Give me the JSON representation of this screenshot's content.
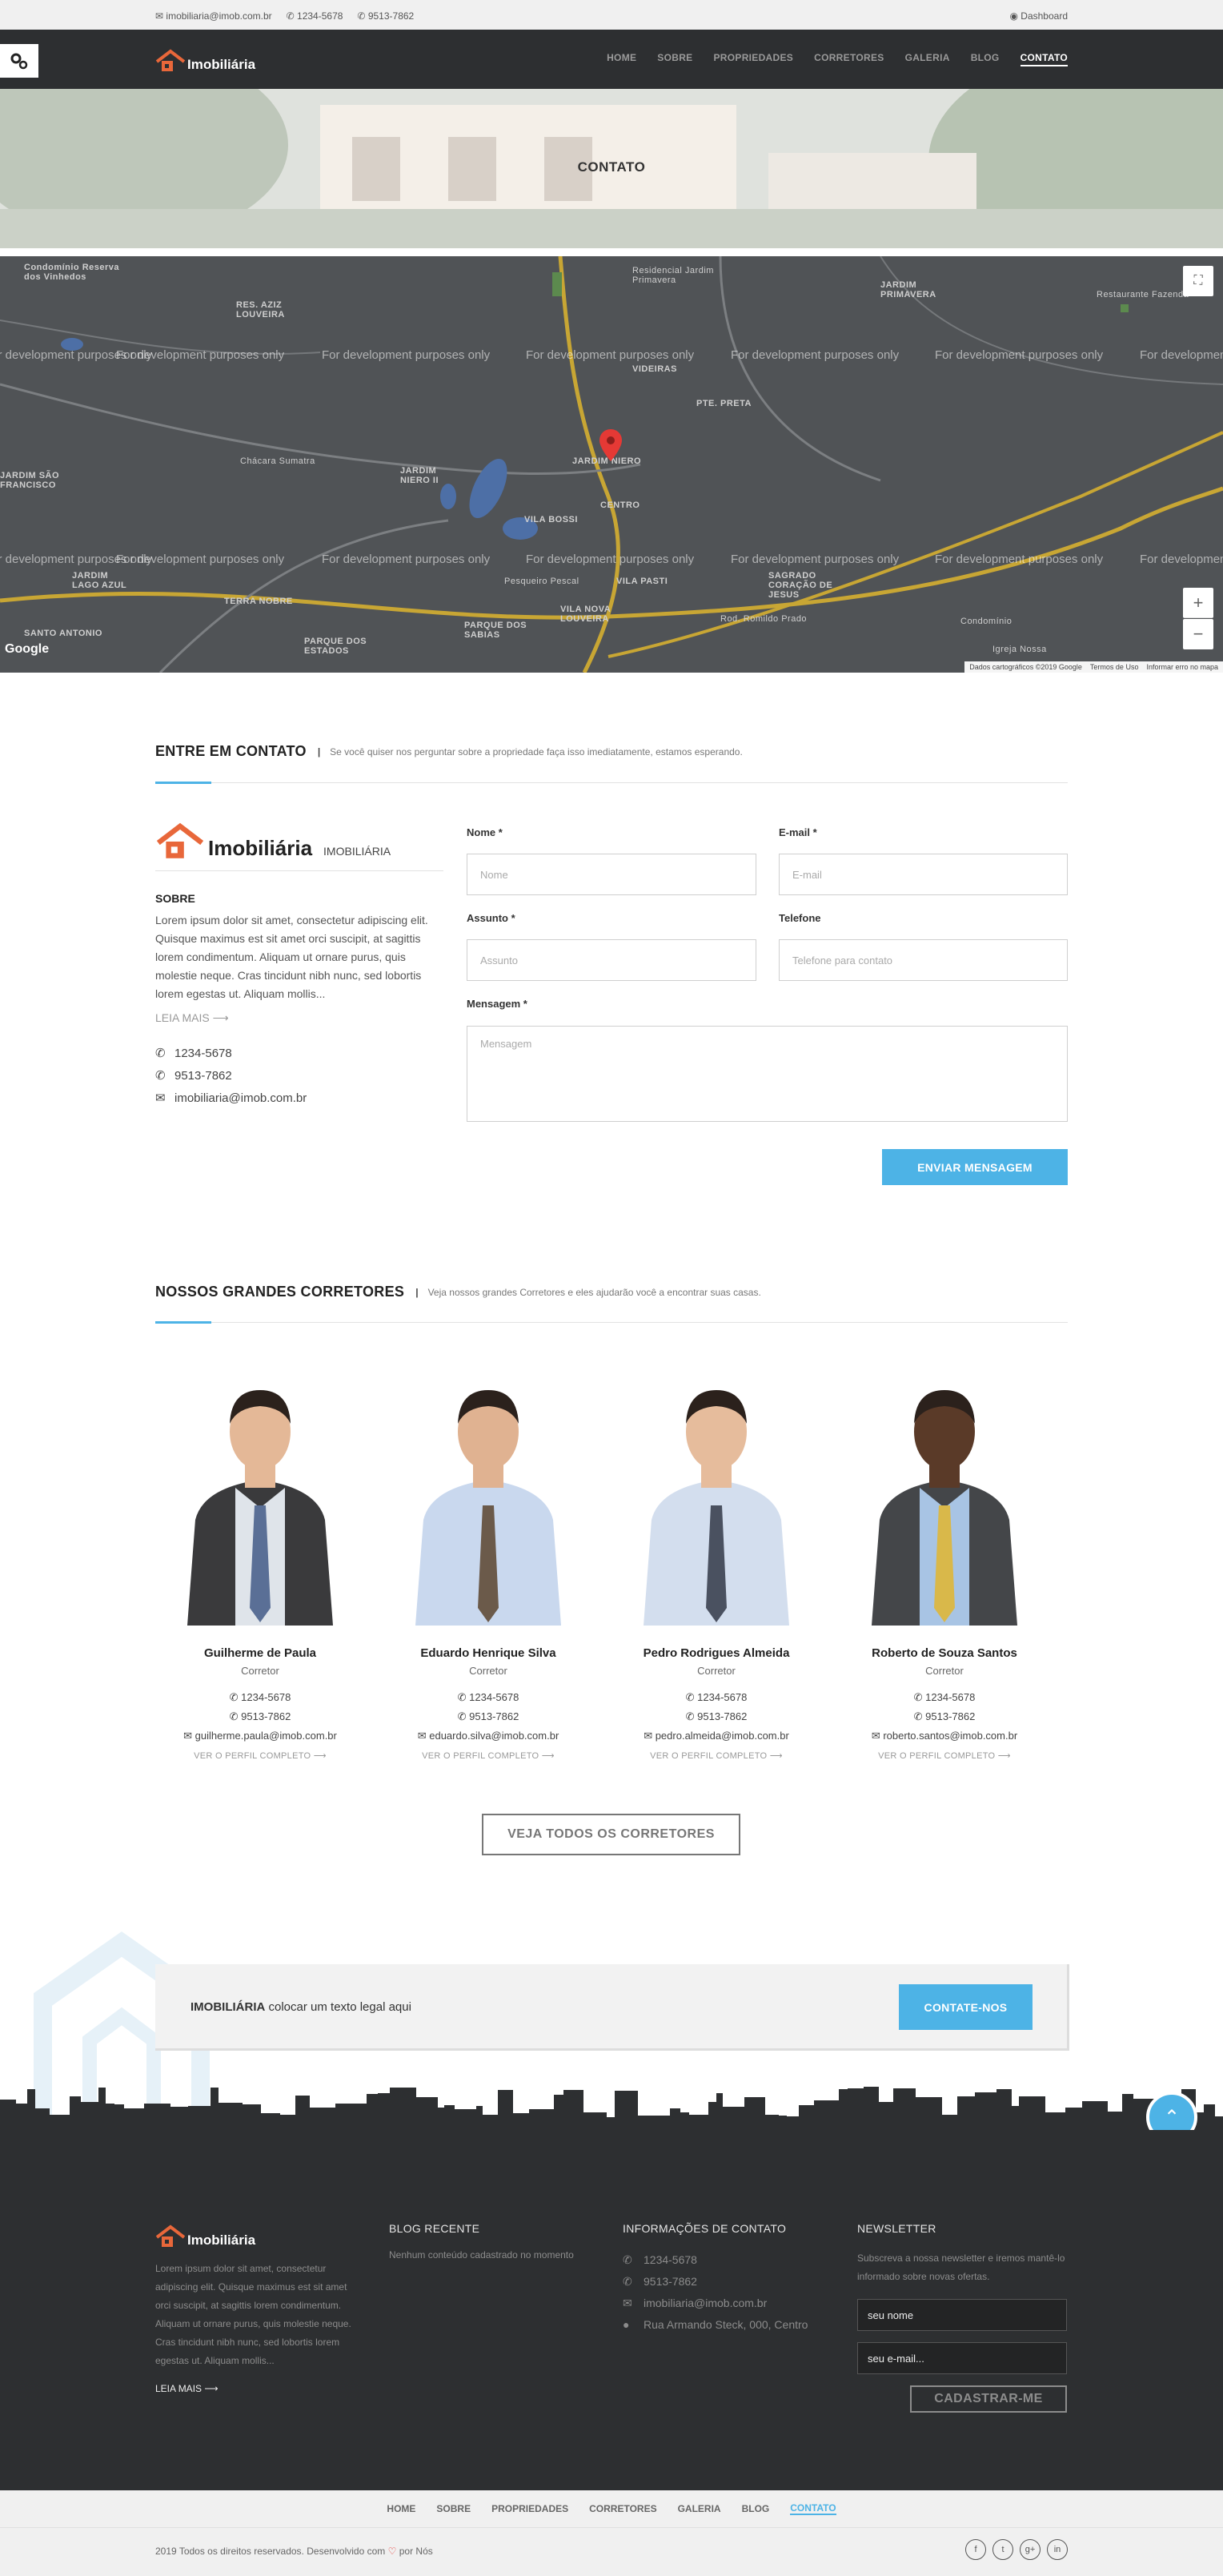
{
  "topbar": {
    "email": "imobiliaria@imob.com.br",
    "phone1": "1234-5678",
    "phone2": "9513-7862",
    "dashboard": "Dashboard"
  },
  "header": {
    "logo_text": "Imobiliária",
    "nav": [
      "HOME",
      "SOBRE",
      "PROPRIEDADES",
      "CORRETORES",
      "GALERIA",
      "BLOG",
      "CONTATO"
    ],
    "active": "CONTATO"
  },
  "banner": {
    "title": "CONTATO"
  },
  "map": {
    "watermark": "For development purposes only",
    "labels": [
      "Condomínio Reserva dos Vinhedos",
      "RES. AZIZ LOUVEIRA",
      "JARDIM PRIMAVERA",
      "VIDEIRAS",
      "PTE. PRETA",
      "JARDIM NIERO",
      "JARDIM NIERO II",
      "CENTRO",
      "VILA BOSSI",
      "VILA PASTI",
      "SAGRADO CORAÇÃO DE JESUS",
      "TERRA NOBRE",
      "JARDIM LAGO AZUL",
      "VILA NOVA LOUVEIRA",
      "PARQUE DOS SABIAS",
      "SANTO ANTONIO",
      "PARQUE DOS ESTADOS",
      "JARDIM SÃO FRANCISCO",
      "Chácara Sumatra",
      "Pesqueiro Pescal",
      "Residencial Jardim Primavera",
      "Restaurante Fazenda",
      "Rod. Romildo Prado",
      "Condomínio",
      "Igreja Nossa"
    ],
    "attribution": [
      "Dados cartográficos ©2019 Google",
      "Termos de Uso",
      "Informar erro no mapa"
    ],
    "zoom_in": "+",
    "zoom_out": "−"
  },
  "contact": {
    "title": "ENTRE EM CONTATO",
    "subtitle": "Se você quiser nos perguntar sobre a propriedade faça isso imediatamente, estamos esperando.",
    "brand": "Imobiliária",
    "brand_sub": "IMOBILIÁRIA",
    "about_title": "SOBRE",
    "about_text": "Lorem ipsum dolor sit amet, consectetur adipiscing elit. Quisque maximus est sit amet orci suscipit, at sagittis lorem condimentum. Aliquam ut ornare purus, quis molestie neque. Cras tincidunt nibh nunc, sed lobortis lorem egestas ut. Aliquam mollis...",
    "read_more": "LEIA MAIS",
    "phone1": "1234-5678",
    "phone2": "9513-7862",
    "email": "imobiliaria@imob.com.br",
    "form": {
      "name_label": "Nome *",
      "name_ph": "Nome",
      "email_label": "E-mail *",
      "email_ph": "E-mail",
      "subject_label": "Assunto *",
      "subject_ph": "Assunto",
      "phone_label": "Telefone",
      "phone_ph": "Telefone para contato",
      "message_label": "Mensagem *",
      "message_ph": "Mensagem",
      "submit": "ENVIAR MENSAGEM"
    }
  },
  "agents_section": {
    "title": "NOSSOS GRANDES CORRETORES",
    "subtitle": "Veja nossos grandes Corretores e eles ajudarão você a encontrar suas casas.",
    "view_all": "VEJA TODOS OS CORRETORES",
    "agents": [
      {
        "name": "Guilherme de Paula",
        "role": "Corretor",
        "phone1": "1234-5678",
        "phone2": "9513-7862",
        "email": "guilherme.paula@imob.com.br",
        "more": "VER O PERFIL COMPLETO",
        "suit": "#3a3a3c",
        "shirt": "#dfe4ea",
        "tie": "#5a6f96",
        "skin": "#e4b897"
      },
      {
        "name": "Eduardo Henrique Silva",
        "role": "Corretor",
        "phone1": "1234-5678",
        "phone2": "9513-7862",
        "email": "eduardo.silva@imob.com.br",
        "more": "VER O PERFIL COMPLETO",
        "suit": "#c9d8ee",
        "shirt": "#c9d8ee",
        "tie": "#6b5a4a",
        "skin": "#e0b291"
      },
      {
        "name": "Pedro Rodrigues Almeida",
        "role": "Corretor",
        "phone1": "1234-5678",
        "phone2": "9513-7862",
        "email": "pedro.almeida@imob.com.br",
        "more": "VER O PERFIL COMPLETO",
        "suit": "#d3deee",
        "shirt": "#d3deee",
        "tie": "#4a5160",
        "skin": "#e6bc9c"
      },
      {
        "name": "Roberto de Souza Santos",
        "role": "Corretor",
        "phone1": "1234-5678",
        "phone2": "9513-7862",
        "email": "roberto.santos@imob.com.br",
        "more": "VER O PERFIL COMPLETO",
        "suit": "#444649",
        "shirt": "#a8c4e4",
        "tie": "#d9b84a",
        "skin": "#5a3a28"
      }
    ]
  },
  "cta": {
    "brand": "IMOBILIÁRIA",
    "text": "colocar um texto legal aqui",
    "button": "CONTATE-NOS"
  },
  "footer": {
    "logo_text": "Imobiliária",
    "about": "Lorem ipsum dolor sit amet, consectetur adipiscing elit. Quisque maximus est sit amet orci suscipit, at sagittis lorem condimentum. Aliquam ut ornare purus, quis molestie neque. Cras tincidunt nibh nunc, sed lobortis lorem egestas ut. Aliquam mollis...",
    "read_more": "LEIA MAIS",
    "blog_title": "BLOG RECENTE",
    "blog_empty": "Nenhum conteúdo cadastrado no momento",
    "info_title": "INFORMAÇÕES DE CONTATO",
    "phone1": "1234-5678",
    "phone2": "9513-7862",
    "email": "imobiliaria@imob.com.br",
    "address": "Rua Armando Steck, 000, Centro",
    "news_title": "NEWSLETTER",
    "news_text": "Subscreva a nossa newsletter e iremos mantê-lo informado sobre novas ofertas.",
    "name_value": "seu nome",
    "email_value": "seu e-mail...",
    "subscribe": "CADASTRAR-ME"
  },
  "bottom_nav": [
    "HOME",
    "SOBRE",
    "PROPRIEDADES",
    "CORRETORES",
    "GALERIA",
    "BLOG",
    "CONTATO"
  ],
  "copyright": {
    "text": "2019 Todos os direitos reservados. Desenvolvido com",
    "by": "por Nós"
  },
  "colors": {
    "accent": "#4db3e6",
    "dark": "#2d2f31",
    "logo_orange": "#e8673a"
  }
}
